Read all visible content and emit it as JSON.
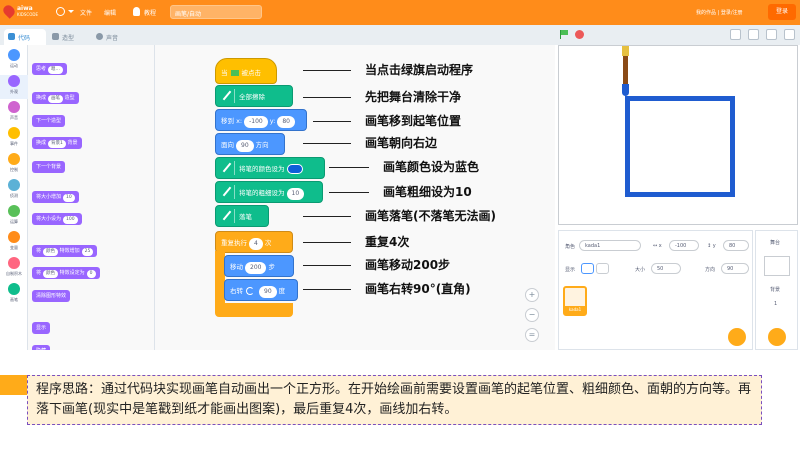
{
  "topbar": {
    "logo_text": "aiwa",
    "logo_sub": "KIDSCODE",
    "file_menu": "文件",
    "edit_menu": "编辑",
    "tutorial_menu": "教程",
    "project_name": "画笔/自动",
    "login_text": "我的作品 | 登录/注册",
    "login_button": "登录"
  },
  "editor_tabs": [
    {
      "label": "代码",
      "active": true
    },
    {
      "label": "造型",
      "active": false
    },
    {
      "label": "声音",
      "active": false
    }
  ],
  "categories": [
    {
      "label": "运动",
      "color": "#4c97ff"
    },
    {
      "label": "外观",
      "color": "#9966ff"
    },
    {
      "label": "声音",
      "color": "#cf63cf"
    },
    {
      "label": "事件",
      "color": "#ffbf00"
    },
    {
      "label": "控制",
      "color": "#ffab19"
    },
    {
      "label": "侦测",
      "color": "#5cb1d6"
    },
    {
      "label": "运算",
      "color": "#59c059"
    },
    {
      "label": "变量",
      "color": "#ff8c1a"
    },
    {
      "label": "自制积木",
      "color": "#ff6680"
    },
    {
      "label": "画笔",
      "color": "#0fbd8c"
    }
  ],
  "palette": {
    "think_label": "思考",
    "think_value": "嗯…",
    "switch_costume_label": "换成",
    "switch_costume_value": "画笔",
    "switch_costume_suffix": "造型",
    "next_costume": "下一个造型",
    "switch_backdrop_label": "换成",
    "switch_backdrop_value": "背景1",
    "switch_backdrop_suffix": "背景",
    "next_backdrop": "下一个背景",
    "change_size_label": "将大小增加",
    "change_size_value": "10",
    "set_size_label": "将大小设为",
    "set_size_value": "100",
    "change_effect_label": "将",
    "change_effect_name": "颜色",
    "change_effect_suffix": "特效增加",
    "change_effect_value": "25",
    "set_effect_label": "将",
    "set_effect_name": "颜色",
    "set_effect_suffix": "特效设定为",
    "set_effect_value": "0",
    "clear_effects": "清除图形特效",
    "show": "显示",
    "hide": "隐藏"
  },
  "script": {
    "when_flag_prefix": "当",
    "when_flag_suffix": "被点击",
    "erase_all": "全部擦除",
    "goto_label": "移到 x:",
    "goto_x": "-100",
    "goto_y_label": "y:",
    "goto_y": "80",
    "point_label": "面向",
    "point_value": "90",
    "point_suffix": "方向",
    "set_color_label": "将笔的颜色设为",
    "set_size_label": "将笔的粗细设为",
    "set_size_value": "10",
    "pen_down": "落笔",
    "repeat_label": "重复执行",
    "repeat_value": "4",
    "repeat_suffix": "次",
    "move_label": "移动",
    "move_value": "200",
    "move_suffix": "步",
    "turn_label": "右转",
    "turn_value": "90",
    "turn_suffix": "度"
  },
  "annotations": [
    "当点击绿旗启动程序",
    "先把舞台清除干净",
    "画笔移到起笔位置",
    "画笔朝向右边",
    "画笔颜色设为蓝色",
    "画笔粗细设为10",
    "画笔落笔(不落笔无法画)",
    "重复4次",
    "画笔移动200步",
    "画笔右转90°(直角)"
  ],
  "zoom": {
    "zoom_in": "+",
    "zoom_out": "−",
    "reset": "="
  },
  "sprite_info": {
    "sprite_label": "角色",
    "sprite_name": "kada1",
    "x_label": "↔ x",
    "x_value": "-100",
    "y_label": "↕ y",
    "y_value": "80",
    "show_label": "显示",
    "size_label": "大小",
    "size_value": "50",
    "direction_label": "方向",
    "direction_value": "90",
    "tile_name": "kada1"
  },
  "stage_panel": {
    "title": "舞台",
    "backdrop_label": "背景",
    "backdrop_count": "1"
  },
  "caption": {
    "text": "程序思路：通过代码块实现画笔自动画出一个正方形。在开始绘画前需要设置画笔的起笔位置、粗细颜色、面朝的方向等。再落下画笔(现实中是笔戳到纸才能画出图案)，最后重复4次，画线加右转。"
  },
  "colors": {
    "topbar": "#ff8c1a",
    "pen": "#0fbd8c",
    "motion": "#4c97ff",
    "control": "#ffab19",
    "event": "#ffbf00",
    "square_line": "#1f5cd0",
    "caption_bg": "#fff1d6",
    "caption_border": "#7a4fbf"
  }
}
